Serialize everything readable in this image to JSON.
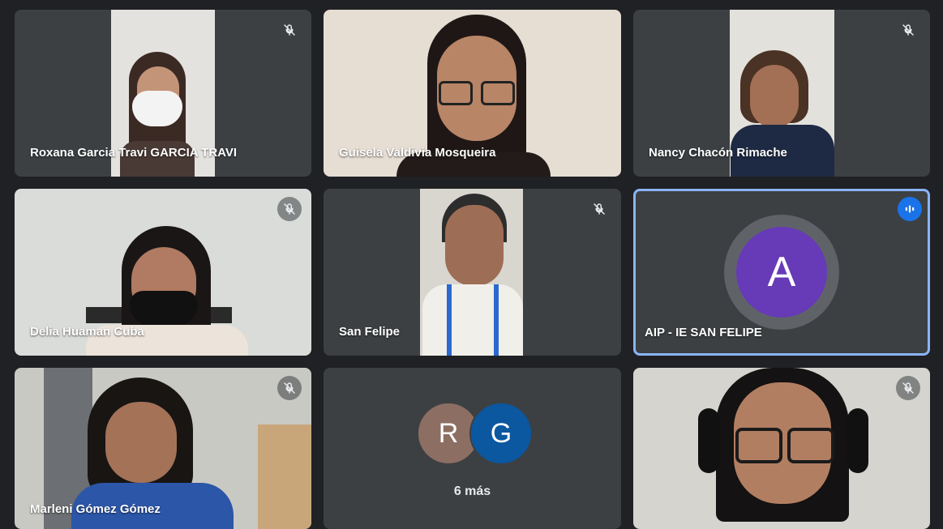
{
  "tiles": [
    {
      "name": "Roxana Garcia Travi GARCIA TRAVI",
      "muted": true
    },
    {
      "name": "Guisela Valdivia Mosqueira",
      "muted": false
    },
    {
      "name": "Nancy Chacón Rimache",
      "muted": true
    },
    {
      "name": "Delia Huaman Cuba",
      "muted": true
    },
    {
      "name": "San Felipe",
      "muted": true
    },
    {
      "name": "AIP - IE SAN FELIPE",
      "muted": false,
      "speaking": true,
      "avatar_letter": "A",
      "avatar_color": "#673ab7"
    },
    {
      "name": "Marleni Gómez Gómez",
      "muted": true
    },
    {
      "overflow": true,
      "avatars": [
        {
          "letter": "R",
          "color": "#8d6e63"
        },
        {
          "letter": "G",
          "color": "#0b57a0"
        }
      ],
      "more_label": "6 más"
    },
    {
      "name": "",
      "muted": true
    }
  ],
  "icons": {
    "muted": "mic-off-icon",
    "speaking": "audio-level-icon"
  }
}
